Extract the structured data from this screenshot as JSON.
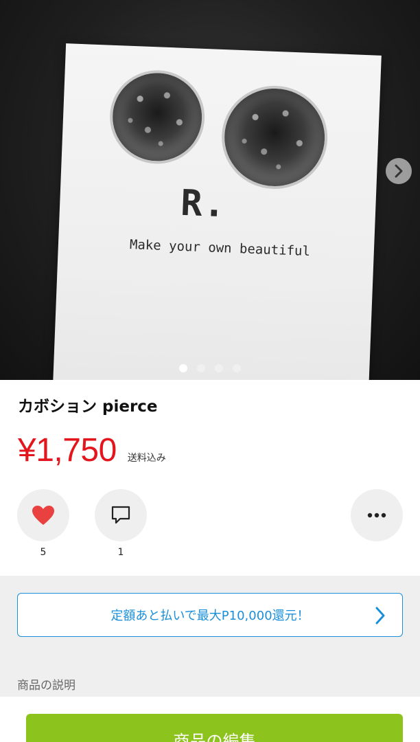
{
  "photo": {
    "brand_mark": "R.",
    "tagline": "Make your own beautiful",
    "next_icon": "chevron-right-icon",
    "page_count": 4,
    "active_page": 1
  },
  "item": {
    "title": "カボション pierce",
    "price": "¥1,750",
    "shipping": "送料込み"
  },
  "actions": {
    "like": {
      "icon": "heart-icon",
      "count": "5",
      "color": "#e8413f"
    },
    "comment": {
      "icon": "comment-icon",
      "count": "1"
    },
    "more": {
      "icon": "more-horizontal-icon"
    }
  },
  "promo": {
    "text": "定額あと払いで最大P10,000還元！",
    "icon": "chevron-right-icon",
    "color": "#1a8fd9"
  },
  "description": {
    "label": "商品の説明"
  },
  "footer": {
    "edit_label": "商品の編集",
    "color": "#8cc31c"
  },
  "colors": {
    "price": "#e3161e"
  }
}
